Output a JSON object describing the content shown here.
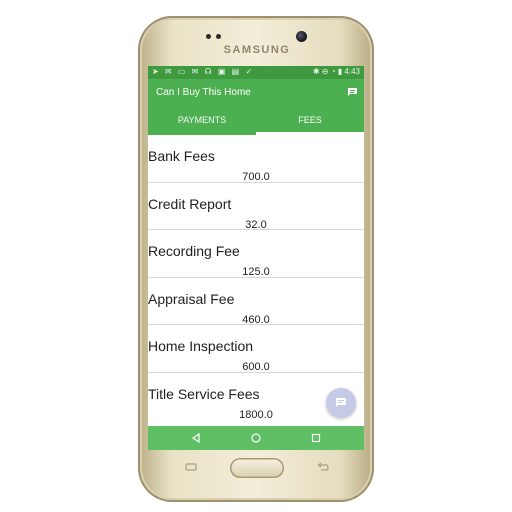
{
  "device": {
    "brand": "SAMSUNG"
  },
  "statusbar": {
    "time": "4:43",
    "left_glyphs": "➤ ✉ ▭ ✉ ☊ ▣ ▤ ✓",
    "right_glyphs": "✱ ⊖ ◔ ▮"
  },
  "appbar": {
    "title": "Can I Buy This Home"
  },
  "tabs": [
    {
      "label": "PAYMENTS",
      "selected": false
    },
    {
      "label": "FEES",
      "selected": true
    }
  ],
  "fees": [
    {
      "label": "Bank Fees",
      "value": "700.0"
    },
    {
      "label": "Credit Report",
      "value": "32.0"
    },
    {
      "label": "Recording Fee",
      "value": "125.0"
    },
    {
      "label": "Appraisal Fee",
      "value": "460.0"
    },
    {
      "label": "Home Inspection",
      "value": "600.0"
    },
    {
      "label": "Title Service Fees",
      "value": "1800.0"
    }
  ],
  "colors": {
    "primary": "#4caf50",
    "statusbar": "#3f9a3f",
    "navbar": "#5fbf64",
    "fab": "#c5cbe6"
  },
  "icons": {
    "appbar_action": "chat-icon",
    "fab": "chat-icon",
    "nav": [
      "back-icon",
      "home-icon",
      "recents-icon"
    ]
  }
}
